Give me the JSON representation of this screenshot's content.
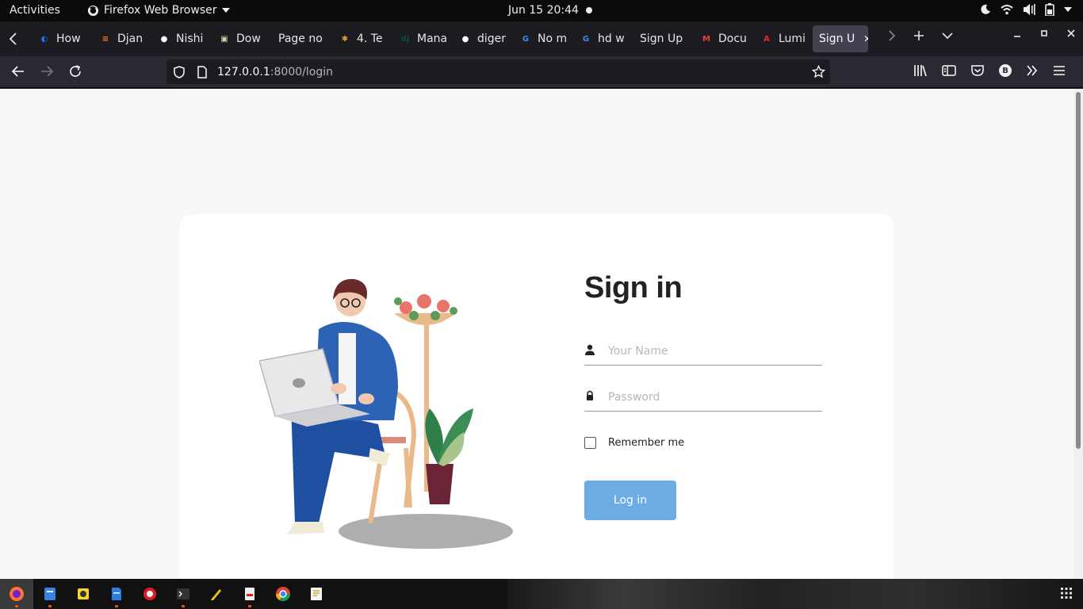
{
  "topbar": {
    "activities": "Activities",
    "app_name": "Firefox Web Browser",
    "clock": "Jun 15  20:44"
  },
  "tabs": [
    {
      "label": "How",
      "icon": "blue-circle-icon",
      "color": "#1a73e8"
    },
    {
      "label": "Djan",
      "icon": "stack-overflow-icon",
      "color": "#f48024"
    },
    {
      "label": "Nishi",
      "icon": "github-icon",
      "color": "#ffffff"
    },
    {
      "label": "Dow",
      "icon": "download-icon",
      "color": "#d8d2a0"
    },
    {
      "label": "Page no",
      "icon": "",
      "color": ""
    },
    {
      "label": "4. Te",
      "icon": "bug-icon",
      "color": "#e0a030"
    },
    {
      "label": "Mana",
      "icon": "django-icon",
      "color": "#0c4b33"
    },
    {
      "label": "diger",
      "icon": "github-icon",
      "color": "#ffffff"
    },
    {
      "label": "No m",
      "icon": "google-icon",
      "color": "#4285f4"
    },
    {
      "label": "hd w",
      "icon": "google-icon",
      "color": "#4285f4"
    },
    {
      "label": "Sign Up",
      "icon": "",
      "color": ""
    },
    {
      "label": "Docu",
      "icon": "gmail-icon",
      "color": "#ea4335"
    },
    {
      "label": "Lumi",
      "icon": "acrobat-icon",
      "color": "#e82a2a"
    },
    {
      "label": "Sign U",
      "icon": "",
      "color": "",
      "active": true
    }
  ],
  "address": {
    "host": "127.0.0.1",
    "rest": ":8000/login"
  },
  "profile_initial": "B",
  "form": {
    "title": "Sign in",
    "name_placeholder": "Your Name",
    "password_placeholder": "Password",
    "remember_label": "Remember me",
    "login_label": "Log in"
  },
  "colors": {
    "login_button": "#6dabe4",
    "page_bg": "#f8f8f8",
    "card_bg": "#ffffff"
  },
  "dock": [
    {
      "name": "firefox-icon",
      "active": true,
      "running": true
    },
    {
      "name": "files-icon",
      "running": true
    },
    {
      "name": "rhythmbox-icon"
    },
    {
      "name": "writer-icon",
      "running": true
    },
    {
      "name": "help-icon"
    },
    {
      "name": "terminal-icon",
      "running": true
    },
    {
      "name": "notes-icon"
    },
    {
      "name": "document-viewer-icon",
      "running": true
    },
    {
      "name": "chrome-icon"
    },
    {
      "name": "text-editor-icon"
    }
  ]
}
